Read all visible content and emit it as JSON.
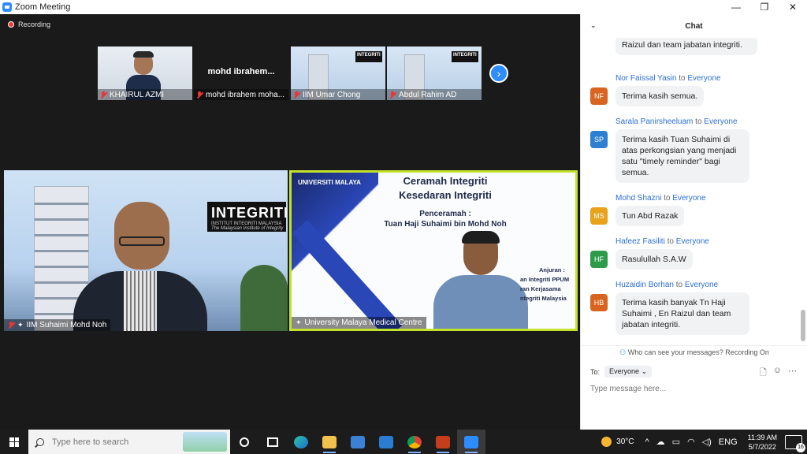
{
  "window": {
    "title": "Zoom Meeting",
    "controls": [
      "—",
      "❐",
      "✕"
    ]
  },
  "meeting": {
    "recording_label": "Recording",
    "thumbnails": [
      {
        "name": "KHAIRUL AZMI",
        "type": "video"
      },
      {
        "name": "mohd ibrahem moha...",
        "display_name": "mohd  ibrahem...",
        "type": "name"
      },
      {
        "name": "IIM Umar Chong",
        "type": "video"
      },
      {
        "name": "Abdul Rahim AD",
        "type": "video"
      }
    ],
    "next_page_icon": "chevron-right-icon",
    "main_videos": [
      {
        "name": "IIM Suhaimi Mohd Noh"
      },
      {
        "name": "University Malaya Medical Centre"
      }
    ],
    "integriti_banner": {
      "title": "INTEGRITI",
      "subtitle": "INSTITUT INTEGRITI MALAYSIA",
      "tagline": "The Malaysian Institute of Integrity"
    },
    "slide": {
      "university": "UNIVERSITI MALAYA",
      "title_line1": "Ceramah Integriti",
      "title_line2": "Kesedaran Integriti",
      "speaker_heading": "Penceramah :",
      "speaker_name": "Tuan Haji Suhaimi bin Mohd Noh",
      "anjuran_heading": "Anjuran :",
      "anjuran_line1": "an Integriti PPUM",
      "anjuran_line2": "ran Kerjasama",
      "anjuran_line3": "ntegriti Malaysia"
    }
  },
  "chat": {
    "title": "Chat",
    "messages": [
      {
        "sender": "",
        "to": "",
        "initials": "",
        "color": "",
        "text": "Raizul dan team  jabatan integriti.",
        "partial": true
      },
      {
        "sender": "Nor Faissal Yasin",
        "to_word": "to",
        "to": "Everyone",
        "initials": "NF",
        "color": "#d9641f",
        "text": "Terima kasih semua."
      },
      {
        "sender": "Sarala Panirsheeluam",
        "to_word": "to",
        "to": "Everyone",
        "initials": "SP",
        "color": "#2c7fd1",
        "text": "Terima kasih Tuan Suhaimi di atas perkongsian yang menjadi satu  \"timely reminder\" bagi semua."
      },
      {
        "sender": "Mohd Shazni",
        "to_word": "to",
        "to": "Everyone",
        "initials": "MS",
        "color": "#e8a21b",
        "text": "Tun Abd Razak"
      },
      {
        "sender": "Hafeez Fasiliti",
        "to_word": "to",
        "to": "Everyone",
        "initials": "HF",
        "color": "#2e9b4b",
        "text": "Rasulullah S.A.W"
      },
      {
        "sender": "Huzaidin Borhan",
        "to_word": "to",
        "to": "Everyone",
        "initials": "HB",
        "color": "#d9641f",
        "text": "Terima kasih banyak Tn Haji Suhaimi  , En Raizul dan team jabatan integriti."
      }
    ],
    "visibility_note": "Who can see your messages? Recording On",
    "to_label": "To:",
    "recipient": "Everyone",
    "input_placeholder": "Type message here..."
  },
  "taskbar": {
    "search_placeholder": "Type here to search",
    "apps": [
      "task-view-icon",
      "edge-icon",
      "file-explorer-icon",
      "store-icon",
      "mail-icon",
      "chrome-icon",
      "powerpoint-icon",
      "zoom-icon"
    ],
    "weather": "30°C",
    "language": "ENG",
    "time": "11:39 AM",
    "date": "5/7/2022",
    "notifications": "16"
  }
}
